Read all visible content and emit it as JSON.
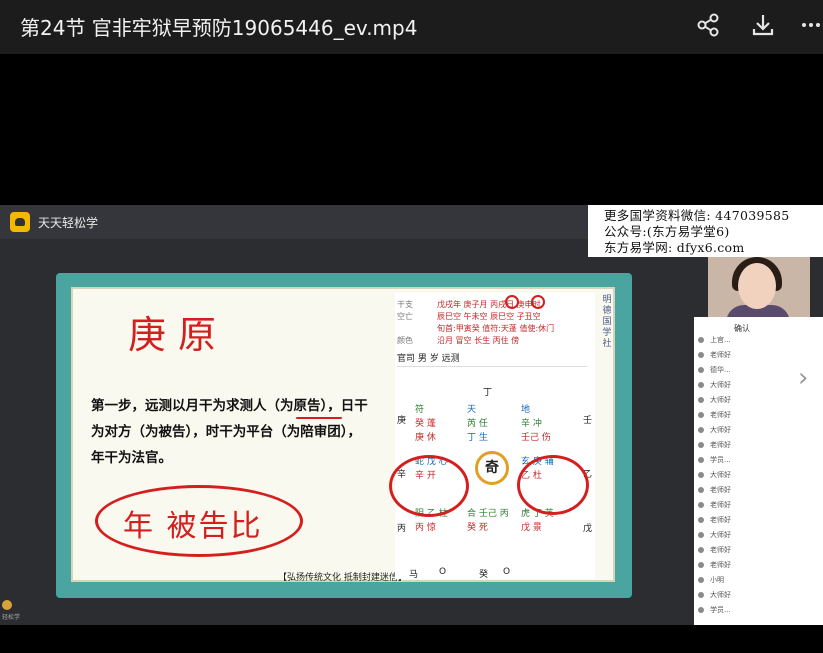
{
  "window": {
    "title": "第24节 官非牢狱早预防19065446_ev.mp4",
    "actions": [
      "share-icon",
      "download-icon",
      "more-icon"
    ]
  },
  "player": {
    "app_name": "天天轻松学",
    "watermark": {
      "line1": "更多国学资料微信: 447039585",
      "line2": "公众号:(东方易学堂6)",
      "line3": "东方易学网: dfyx6.com"
    }
  },
  "slide": {
    "handwritten_title": "庚原",
    "step_text": "第一步，远测以月干为求测人（为原告），日干为对方（为被告），时干为平台（为陪审团），年干为法官。",
    "handwritten_note": "年 被告比",
    "footer": "【弘扬传统文化  抵制封建迷信】",
    "vertical_label": "明德国学社",
    "chart": {
      "rows": [
        {
          "label": "干支",
          "value": "戊戌年 庚子月 丙戌日 庚申时"
        },
        {
          "label": "空亡",
          "value": "辰巳空 午未空 辰巳空 子丑空"
        },
        {
          "label": "",
          "value": "旬首:甲寅癸  值符:天蓬  值使:休门"
        },
        {
          "label": "颜色",
          "value": "沿月 冒空 长生 丙住 傍"
        }
      ],
      "case": "官司 男 岁 远测",
      "top_stem": "丁",
      "left_stems": [
        "庚",
        "辛",
        "丙"
      ],
      "right_stems": [
        "壬",
        "乙",
        "戊"
      ],
      "bottom": [
        "马",
        "O",
        "癸",
        "O"
      ],
      "cells": [
        [
          "符",
          "天",
          "地"
        ],
        [
          "癸 蓬",
          "芮 任",
          "辛 冲"
        ],
        [
          "庚 休",
          "丁 生",
          "壬己 伤"
        ],
        [
          "蛇 戊 心",
          "奇",
          "玄 庚 辅"
        ],
        [
          "辛 开",
          "",
          "乙 杜"
        ],
        [
          "阴 乙 柱",
          "合 壬己 丙",
          "虎 丁 英"
        ],
        [
          "丙 惊",
          "癸 死",
          "戊 景"
        ]
      ],
      "center": "奇"
    }
  },
  "participants": {
    "header": "确认",
    "items": [
      "上官...",
      "老师好",
      "德华...",
      "大师好",
      "大师好",
      "老师好",
      "大师好",
      "老师好",
      "学员...",
      "大师好",
      "老师好",
      "老师好",
      "老师好",
      "大师好",
      "老师好",
      "老师好",
      "小明",
      "大师好",
      "学员..."
    ]
  },
  "bottom_caption": "轻松学"
}
